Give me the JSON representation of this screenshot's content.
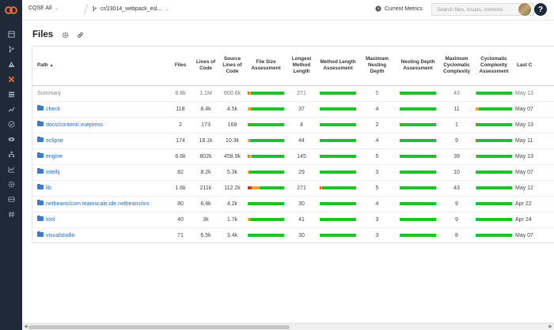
{
  "topbar": {
    "project": "CQSE All",
    "branch": "cr/23014_webpack_esl...",
    "metrics_label": "Current Metrics",
    "search_placeholder": "Search files, issues, commits",
    "help_glyph": "?"
  },
  "page": {
    "title": "Files"
  },
  "table": {
    "columns": [
      {
        "key": "path",
        "label": "Path"
      },
      {
        "key": "files",
        "label": "Files"
      },
      {
        "key": "loc",
        "label": "Lines of Code"
      },
      {
        "key": "sloc",
        "label": "Source Lines of Code"
      },
      {
        "key": "fsa",
        "label": "File Size Assessment"
      },
      {
        "key": "lml",
        "label": "Longest Method Length"
      },
      {
        "key": "mla",
        "label": "Method Length Assessment"
      },
      {
        "key": "mnd",
        "label": "Maximum Nesting Depth"
      },
      {
        "key": "nda",
        "label": "Nesting Depth Assessment"
      },
      {
        "key": "mcc",
        "label": "Maximum Cyclomatic Complexity"
      },
      {
        "key": "cca",
        "label": "Cyclomatic Complexity Assessment"
      },
      {
        "key": "lc",
        "label": "Last C"
      }
    ],
    "rows": [
      {
        "path": "Summary",
        "summary": true,
        "files": "8.8k",
        "loc": "1.1M",
        "sloc": "600.6k",
        "fsa": [
          0.03,
          0.06,
          0.91
        ],
        "lml": "271",
        "mla": [
          0,
          0,
          1
        ],
        "mnd": "5",
        "nda": [
          0,
          0,
          1
        ],
        "mcc": "43",
        "cca": [
          0,
          0.02,
          0.98
        ],
        "lc": "May 13"
      },
      {
        "path": "check",
        "files": "118",
        "loc": "8.4k",
        "sloc": "4.5k",
        "fsa": [
          0,
          0.08,
          0.92
        ],
        "lml": "37",
        "mla": [
          0,
          0,
          1
        ],
        "mnd": "4",
        "nda": [
          0,
          0,
          1
        ],
        "mcc": "11",
        "cca": [
          0,
          0.08,
          0.92
        ],
        "lc": "May 07"
      },
      {
        "path": "docs/content/.vuepress",
        "files": "2",
        "loc": "173",
        "sloc": "168",
        "fsa": [
          0,
          0,
          1
        ],
        "lml": "4",
        "mla": [
          0,
          0,
          1
        ],
        "mnd": "2",
        "nda": [
          0,
          0,
          1
        ],
        "mcc": "1",
        "cca": [
          0,
          0,
          1
        ],
        "lc": "May 13"
      },
      {
        "path": "eclipse",
        "files": "174",
        "loc": "18.1k",
        "sloc": "10.3k",
        "fsa": [
          0,
          0.06,
          0.94
        ],
        "lml": "44",
        "mla": [
          0,
          0,
          1
        ],
        "mnd": "4",
        "nda": [
          0,
          0,
          1
        ],
        "mcc": "9",
        "cca": [
          0,
          0,
          1
        ],
        "lc": "May 11"
      },
      {
        "path": "engine",
        "files": "6.6k",
        "loc": "802k",
        "sloc": "458.9k",
        "fsa": [
          0.03,
          0.08,
          0.89
        ],
        "lml": "145",
        "mla": [
          0,
          0,
          1
        ],
        "mnd": "5",
        "nda": [
          0,
          0,
          1
        ],
        "mcc": "39",
        "cca": [
          0,
          0.03,
          0.97
        ],
        "lc": "May 13"
      },
      {
        "path": "intellij",
        "files": "82",
        "loc": "8.2k",
        "sloc": "5.3k",
        "fsa": [
          0,
          0.04,
          0.96
        ],
        "lml": "29",
        "mla": [
          0,
          0,
          1
        ],
        "mnd": "3",
        "nda": [
          0,
          0,
          1
        ],
        "mcc": "10",
        "cca": [
          0,
          0,
          1
        ],
        "lc": "May 07"
      },
      {
        "path": "lib",
        "files": "1.6k",
        "loc": "211k",
        "sloc": "112.2k",
        "fsa": [
          0.1,
          0.22,
          0.68
        ],
        "lml": "271",
        "mla": [
          0.03,
          0.03,
          0.94
        ],
        "mnd": "5",
        "nda": [
          0,
          0,
          1
        ],
        "mcc": "43",
        "cca": [
          0,
          0.03,
          0.97
        ],
        "lc": "May 12"
      },
      {
        "path": "netbeans/com.teamscale.ide.netbeans/src",
        "files": "80",
        "loc": "6.8k",
        "sloc": "4.2k",
        "fsa": [
          0,
          0,
          1
        ],
        "lml": "30",
        "mla": [
          0,
          0,
          1
        ],
        "mnd": "4",
        "nda": [
          0,
          0,
          1
        ],
        "mcc": "9",
        "cca": [
          0,
          0,
          1
        ],
        "lc": "Apr 22"
      },
      {
        "path": "tool",
        "files": "40",
        "loc": "3k",
        "sloc": "1.7k",
        "fsa": [
          0,
          0.06,
          0.94
        ],
        "lml": "41",
        "mla": [
          0,
          0,
          1
        ],
        "mnd": "3",
        "nda": [
          0,
          0,
          1
        ],
        "mcc": "9",
        "cca": [
          0,
          0,
          1
        ],
        "lc": "Apr 24"
      },
      {
        "path": "visualstudio",
        "files": "71",
        "loc": "6.5k",
        "sloc": "3.4k",
        "fsa": [
          0,
          0,
          1
        ],
        "lml": "30",
        "mla": [
          0,
          0,
          1
        ],
        "mnd": "3",
        "nda": [
          0,
          0,
          1
        ],
        "mcc": "8",
        "cca": [
          0,
          0,
          1
        ],
        "lc": "May 07"
      }
    ]
  },
  "colors": {
    "red": "#d9302a",
    "orange": "#f5a623",
    "green": "#1dc32b",
    "link": "#2a6ab8",
    "sidebar": "#1f2a38",
    "accent": "#f0653a"
  },
  "sidebar_icons": [
    "dashboard-icon",
    "branch-icon",
    "warning-icon",
    "tools-icon",
    "list-icon",
    "trend-icon",
    "check-icon",
    "eye-icon",
    "hierarchy-icon",
    "chart-icon",
    "gear-icon",
    "archive-icon",
    "hash-icon"
  ]
}
